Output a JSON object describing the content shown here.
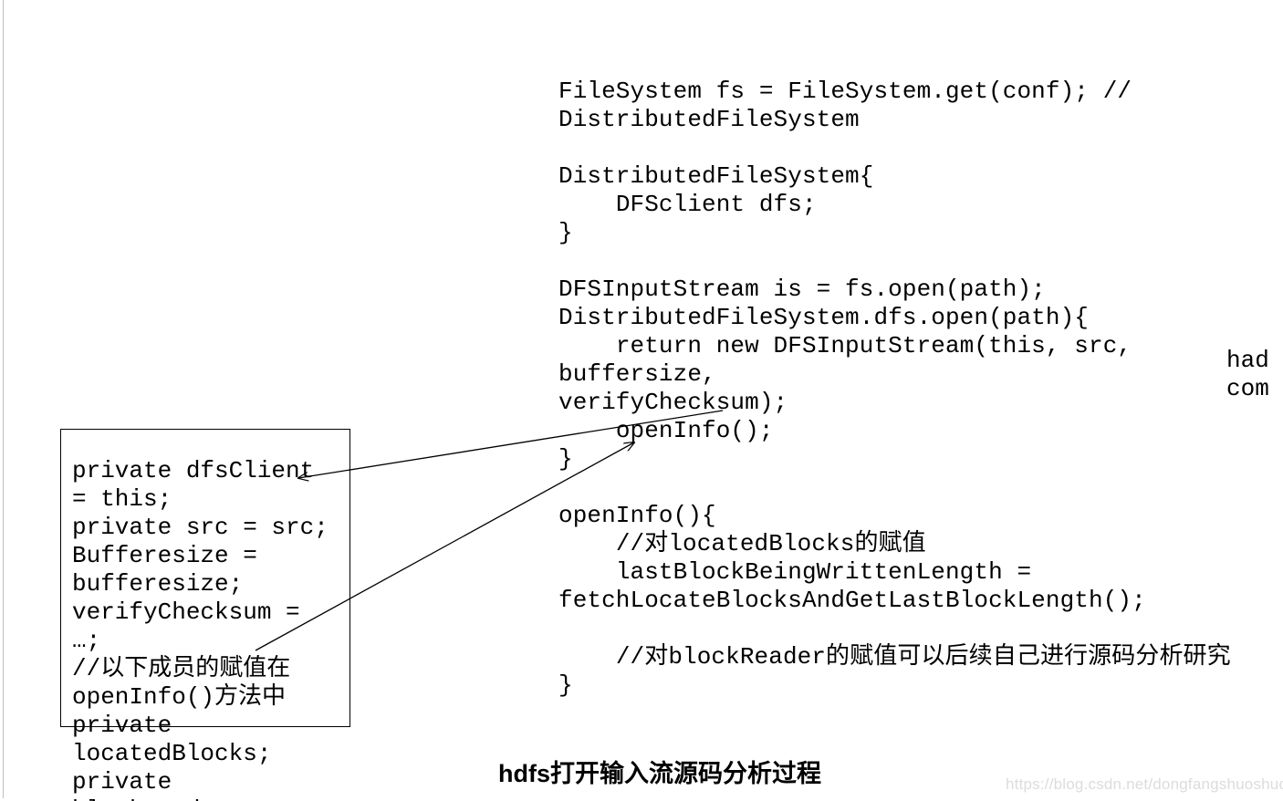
{
  "main_code": "FileSystem fs = FileSystem.get(conf); //\nDistributedFileSystem\n\nDistributedFileSystem{\n    DFSclient dfs;\n}\n\nDFSInputStream is = fs.open(path);\nDistributedFileSystem.dfs.open(path){\n    return new DFSInputStream(this, src, buffersize,\nverifyChecksum);\n    openInfo();\n}\n\nopenInfo(){\n    //对locatedBlocks的赋值\n    lastBlockBeingWrittenLength =\nfetchLocateBlocksAndGetLastBlockLength();\n\n    //对blockReader的赋值可以后续自己进行源码分析研究\n}",
  "box_code": "private dfsClient = this;\nprivate src = src;\nBufferesize = bufferesize;\nverifyChecksum = …;\n//以下成员的赋值在openInfo()方法中\nprivate locatedBlocks;\nprivate blockReader;",
  "title": "hdfs打开输入流源码分析过程",
  "edge_labels": {
    "right_top": "had",
    "right_bottom": "com"
  },
  "watermark": "https://blog.csdn.net/dongfangshuoshuo",
  "chart_data": {
    "type": "diagram",
    "title": "hdfs打开输入流源码分析过程",
    "nodes": [
      {
        "id": "main_code",
        "kind": "code-block",
        "lines": [
          "FileSystem fs = FileSystem.get(conf); // DistributedFileSystem",
          "",
          "DistributedFileSystem{",
          "    DFSclient dfs;",
          "}",
          "",
          "DFSInputStream is = fs.open(path);",
          "DistributedFileSystem.dfs.open(path){",
          "    return new DFSInputStream(this, src, buffersize, verifyChecksum);",
          "    openInfo();",
          "}",
          "",
          "openInfo(){",
          "    //对locatedBlocks的赋值",
          "    lastBlockBeingWrittenLength = fetchLocateBlocksAndGetLastBlockLength();",
          "",
          "    //对blockReader的赋值可以后续自己进行源码分析研究",
          "}"
        ]
      },
      {
        "id": "box_code",
        "kind": "boxed-code-block",
        "lines": [
          "private dfsClient = this;",
          "private src = src;",
          "Bufferesize = bufferesize;",
          "verifyChecksum = …;",
          "//以下成员的赋值在openInfo()方法中",
          "private locatedBlocks;",
          "private blockReader;"
        ]
      },
      {
        "id": "cutoff_right",
        "kind": "cut-off-text",
        "lines": [
          "had",
          "com"
        ]
      }
    ],
    "edges": [
      {
        "from": "main_code",
        "from_anchor": "openInfo();",
        "to": "box_code",
        "to_anchor": "private dfsClient = this;",
        "style": "arrow"
      },
      {
        "from": "box_code",
        "from_anchor": "//以下成员的赋值在openInfo()方法中",
        "to": "main_code",
        "to_anchor": "openInfo(){",
        "style": "arrow"
      }
    ],
    "watermark": "https://blog.csdn.net/dongfangshuoshuo"
  }
}
